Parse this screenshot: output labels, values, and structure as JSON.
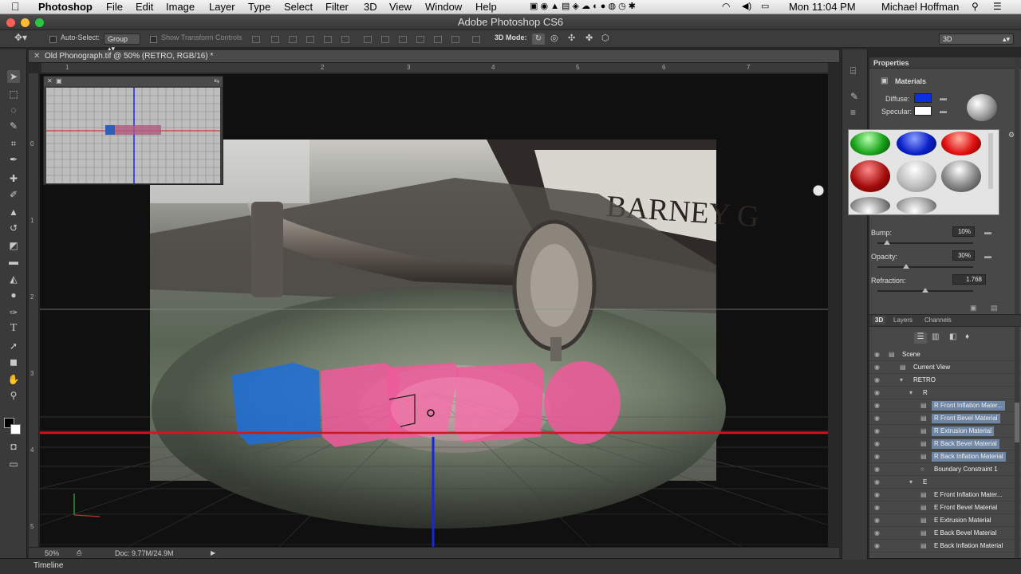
{
  "menubar": {
    "apple": "",
    "app": "Photoshop",
    "items": [
      "File",
      "Edit",
      "Image",
      "Layer",
      "Type",
      "Select",
      "Filter",
      "3D",
      "View",
      "Window",
      "Help"
    ],
    "clock": "Mon 11:04 PM",
    "user": "Michael Hoffman"
  },
  "titlebar": {
    "title": "Adobe Photoshop CS6"
  },
  "options": {
    "auto_select_label": "Auto-Select:",
    "auto_select_value": "Group",
    "show_transform_label": "Show Transform Controls",
    "mode_3d_label": "3D Mode:",
    "workspace": "3D"
  },
  "document": {
    "tab_title": "Old Phonograph.tif @ 50% (RETRO, RGB/16) *",
    "zoom": "50%",
    "doc_info": "Doc: 9.77M/24.9M",
    "h_ruler": [
      "1",
      "2",
      "3",
      "4",
      "5",
      "6",
      "7"
    ],
    "v_ruler": [
      "0",
      "1",
      "2",
      "3",
      "4",
      "5"
    ],
    "retro_text": "RETRO",
    "sign_text": "BARNEY G"
  },
  "properties": {
    "header": "Properties",
    "tab": "Materials",
    "diffuse_label": "Diffuse:",
    "specular_label": "Specular:",
    "bump_label": "Bump:",
    "bump_value": "10%",
    "bump_fraction": 0.1,
    "opacity_label": "Opacity:",
    "opacity_value": "30%",
    "opacity_fraction": 0.3,
    "refraction_label": "Refraction:",
    "refraction_value": "1.768",
    "diffuse_color": "#0a2fe0",
    "specular_color": "#ffffff"
  },
  "panel3d": {
    "tabs": [
      "3D",
      "Layers",
      "Channels"
    ],
    "rows": [
      {
        "label": "Scene",
        "hl": false
      },
      {
        "label": "Current View",
        "hl": false
      },
      {
        "label": "RETRO",
        "hl": false
      },
      {
        "label": "R",
        "hl": false
      },
      {
        "label": "R Front Inflation Mater...",
        "hl": true
      },
      {
        "label": "R Front Bevel Material",
        "hl": true
      },
      {
        "label": "R Extrusion Material",
        "hl": true
      },
      {
        "label": "R Back Bevel Material",
        "hl": true
      },
      {
        "label": "R Back Inflation Material",
        "hl": true
      },
      {
        "label": "Boundary Constraint 1",
        "hl": false
      },
      {
        "label": "E",
        "hl": false
      },
      {
        "label": "E Front Inflation Mater...",
        "hl": false
      },
      {
        "label": "E Front Bevel Material",
        "hl": false
      },
      {
        "label": "E Extrusion Material",
        "hl": false
      },
      {
        "label": "E Back Bevel Material",
        "hl": false
      },
      {
        "label": "E Back Inflation Material",
        "hl": false
      }
    ]
  },
  "timeline": {
    "label": "Timeline"
  },
  "colors": {
    "accent_selection": "#6f85a4",
    "axis_red": "#d01818",
    "axis_blue": "#1428e0",
    "retro_pink": "#ee5a9a",
    "retro_blue": "#1e6fd8"
  },
  "icons": [
    "apple-icon",
    "move-tool-icon",
    "marquee-icon",
    "lasso-icon",
    "quick-select-icon",
    "crop-icon",
    "eyedropper-icon",
    "healing-icon",
    "brush-icon",
    "stamp-icon",
    "history-brush-icon",
    "eraser-icon",
    "gradient-icon",
    "blur-icon",
    "dodge-icon",
    "pen-icon",
    "type-icon",
    "path-select-icon",
    "shape-icon",
    "hand-icon",
    "zoom-icon",
    "eye-icon",
    "search-icon",
    "wifi-icon"
  ]
}
